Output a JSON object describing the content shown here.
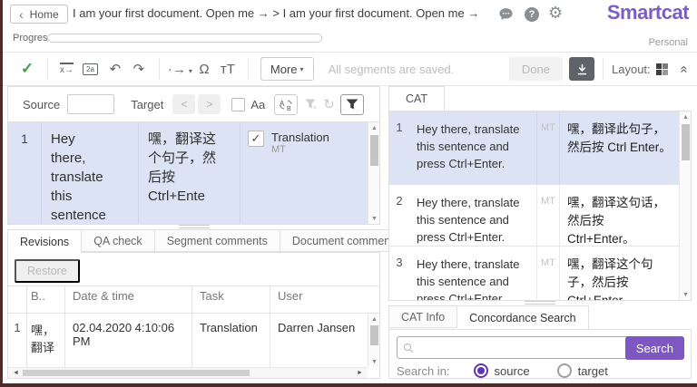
{
  "topbar": {
    "home_label": "Home",
    "breadcrumb": "I am your first document. Open me → > I am your first document. Open me →",
    "brand": "Smartcat",
    "account_type": "Personal"
  },
  "progress": {
    "label": "Progress"
  },
  "toolbar": {
    "more_label": "More",
    "status_text": "All segments are saved.",
    "done_label": "Done",
    "layout_label": "Layout:"
  },
  "icons": {
    "back_chevron": "‹",
    "check": "✓",
    "copy_text": "x→",
    "find_replace": "2a",
    "undo": "↶",
    "redo": "↷",
    "dot_arrow": "·→",
    "omega": "Ω",
    "change_case": "тT",
    "caret_down": "▾",
    "help": "?",
    "gear": "⚙",
    "collapse": "«",
    "prev": "<",
    "next": ">",
    "swap": "A⇄B",
    "sync": "↻",
    "up": "▲",
    "down": "▼",
    "left": "◄",
    "right": "►"
  },
  "editor": {
    "source_label": "Source",
    "target_label": "Target",
    "match_case_label": "Aa",
    "segments": [
      {
        "num": "1",
        "source": "Hey there, translate this sentence",
        "target": "嘿，翻译这个句子，然后按 Ctrl+Ente",
        "status": "Translation",
        "status_type": "MT"
      }
    ]
  },
  "revisions": {
    "tabs": [
      {
        "label": "Revisions"
      },
      {
        "label": "QA check"
      },
      {
        "label": "Segment comments"
      },
      {
        "label": "Document comments"
      }
    ],
    "restore_label": "Restore",
    "columns": {
      "before": "B..",
      "datetime": "Date & time",
      "task": "Task",
      "user": "User"
    },
    "rows": [
      {
        "num": "1",
        "before": "嘿，翻译",
        "datetime": "02.04.2020 4:10:06 PM",
        "task": "Translation",
        "user": "Darren Jansen"
      }
    ]
  },
  "cat": {
    "tab_label": "CAT",
    "rows": [
      {
        "num": "1",
        "source": "Hey there, translate this sentence and press Ctrl+Enter.",
        "type": "MT",
        "target": "嘿，翻译此句子，然后按 Ctrl Enter。"
      },
      {
        "num": "2",
        "source": "Hey there, translate this sentence and press Ctrl+Enter.",
        "type": "MT",
        "target": "嘿，翻译这句话，然后按 Ctrl+Enter。"
      },
      {
        "num": "3",
        "source": "Hey there, translate this sentence and press Ctrl+Enter.",
        "type": "MT",
        "target": "嘿，翻译这个句子，然后按Ctrl+Enter。"
      }
    ]
  },
  "concordance": {
    "tabs": [
      {
        "label": "CAT Info"
      },
      {
        "label": "Concordance Search"
      }
    ],
    "search_button": "Search",
    "search_in_label": "Search in:",
    "options": [
      {
        "label": "source"
      },
      {
        "label": "target"
      }
    ]
  },
  "colors": {
    "brand": "#7b5fc0",
    "accent": "#7e57c2",
    "highlight": "#dbe3f5",
    "success": "#43a047"
  }
}
